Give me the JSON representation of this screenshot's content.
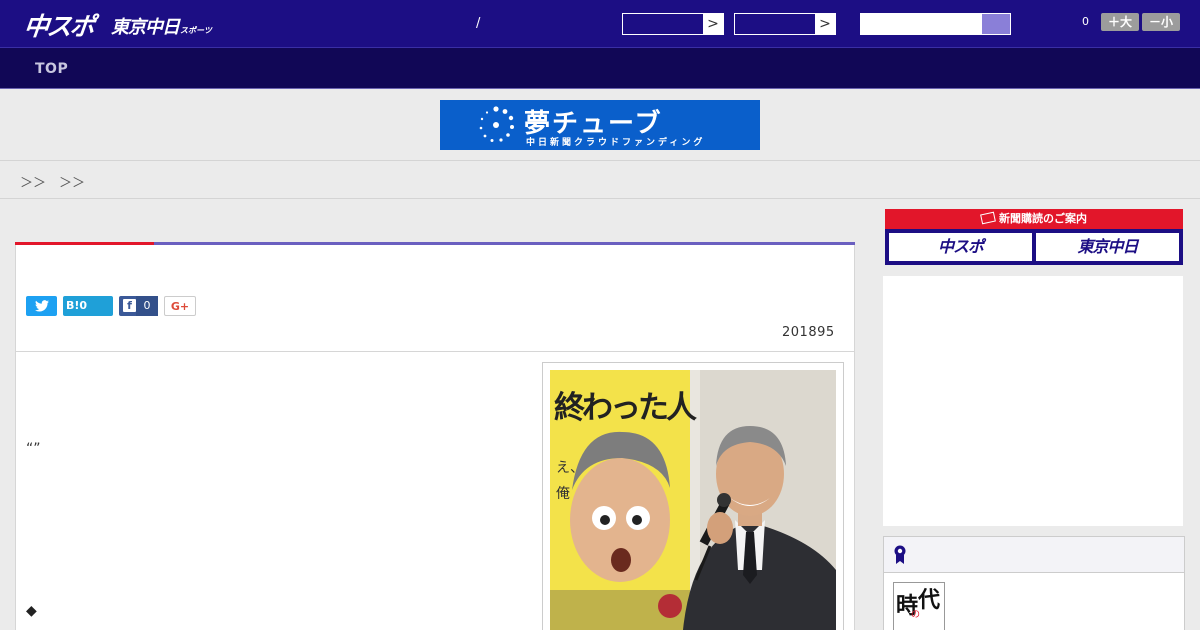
{
  "header": {
    "logo_main": "中スポ",
    "logo_sub": "東京中日",
    "logo_sub_small": "スポーツ",
    "date_slash": "/",
    "select_arrow_1": ">",
    "select_arrow_2": ">",
    "search_placeholder": "",
    "count": "0",
    "font_up_label": "＋大",
    "font_down_label": "－小"
  },
  "nav": {
    "top_label": "TOP"
  },
  "banner": {
    "title": "夢チューブ",
    "subtitle": "中日新聞クラウドファンディング"
  },
  "breadcrumb": {
    "text": "＞＞　＞＞"
  },
  "article": {
    "share_twitter_count": "",
    "share_hatena": "B!0",
    "share_facebook_count": "0",
    "share_google": "G+",
    "date": "201895",
    "quote_marks": "“”",
    "diamond": "◆",
    "poster_title": "終わった人"
  },
  "sidebar": {
    "subscribe_heading": "新聞購読のご案内",
    "subscribe_left": "中スポ",
    "subscribe_right": "東京中日"
  },
  "colors": {
    "header_bg": "#1c0e84",
    "nav_bg": "#110756",
    "accent_red": "#e2162a",
    "accent_purple": "#6a5fc0",
    "banner_blue": "#0a5fcb"
  }
}
